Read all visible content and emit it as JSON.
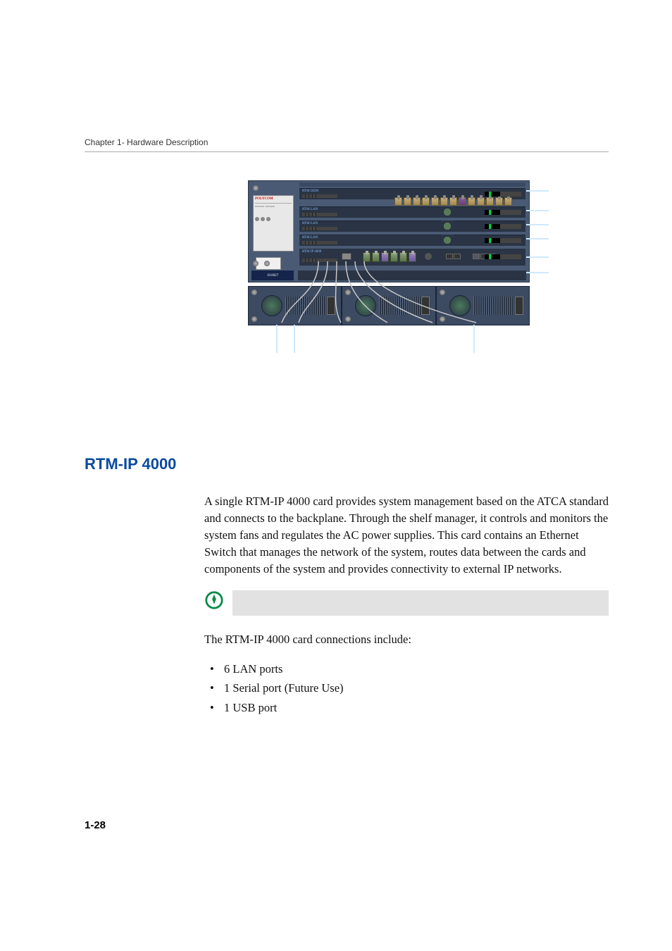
{
  "header": {
    "chapter_label": "Chapter 1- Hardware Description"
  },
  "figure": {
    "brand": "POLYCOM",
    "slots": {
      "isdn": "RTM ISDN",
      "lan_a": "RTM LAN",
      "lan_b": "RTM LAN",
      "lan_c": "RTM LAN",
      "ip": "RTM IP 4000"
    }
  },
  "section": {
    "heading": "RTM-IP 4000",
    "paragraph": "A single RTM-IP 4000 card provides system management based on the ATCA standard and connects to the backplane. Through the shelf manager, it controls and monitors the system fans and regulates the AC power supplies. This card contains an Ethernet Switch that manages the network of the system, routes data between the cards and components of the system and provides connectivity to external IP networks.",
    "connections_intro": "The RTM-IP 4000 card connections include:",
    "bullets": {
      "lan": "6 LAN ports",
      "serial": "1 Serial port (Future Use)",
      "usb": "1 USB port"
    }
  },
  "page_number": "1-28"
}
